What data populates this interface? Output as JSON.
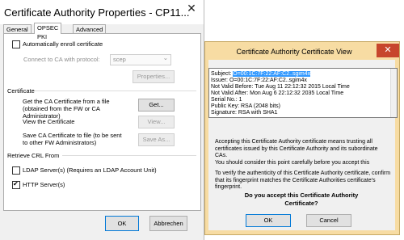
{
  "window1": {
    "title": "Certificate Authority Properties - CP11...",
    "close_glyph": "✕",
    "tabs": [
      "General",
      "OPSEC PKI",
      "Advanced"
    ],
    "auto_enroll_label": "Automatically enroll certificate",
    "connect_label": "Connect to CA with protocol:",
    "protocol_value": "scep",
    "protocol_arrow": "⌄",
    "properties_button": "Properties...",
    "certificate_group": "Certificate",
    "get_cert_text": "Get the CA Certificate from a file (obtained from the FW or CA Administrator)",
    "get_button": "Get...",
    "view_cert_text": "View the Certificate",
    "view_button": "View...",
    "save_cert_text": "Save CA Certificate to file (to be sent to other FW Administrators)",
    "save_button": "Save As...",
    "retrieve_crl_group": "Retrieve CRL From",
    "ldap_label": "LDAP Server(s) (Requires an LDAP Account Unit)",
    "http_label": "HTTP Server(s)",
    "ok_button": "OK",
    "cancel_button": "Abbrechen",
    "auto_enroll_checked": false,
    "ldap_checked": false,
    "http_checked": true
  },
  "window2": {
    "title": "Certificate Authority Certificate View",
    "close_glyph": "✕",
    "subject_label": "Subject:",
    "subject_value": "O=00:1C:7F:22:AF:C2..sgim4x",
    "issuer": "Issuer: O=00:1C:7F:22:AF:C2..sgim4x",
    "not_valid_before": "Not Valid Before: Tue Aug 11 22:12:32 2015 Local Time",
    "not_valid_after": "Not Valid After:  Mon Aug  6 22:12:32 2035 Local Time",
    "serial": "Serial No.: 1",
    "public_key": "Public Key: RSA (2048 bits)",
    "signature": "Signature: RSA with SHA1",
    "para1": "Accepting this Certificate Authority certificate means trusting all certificates issued by this Certificate Authority and its subordinate CAs.",
    "para2": "You should consider this point carefully before you accept this",
    "para3": "To verify the authenticity of this Certificate Authority certificate, confirm that its fingerprint matches the Certificate Authorities certificate's fingerprint.",
    "question": "Do you accept this Certificate Authority Certificate?",
    "ok_button": "OK",
    "cancel_button": "Cancel"
  },
  "colors": {
    "dialog_frame": "#f7dca3",
    "close_button": "#c7462c",
    "selection": "#3399ff"
  }
}
